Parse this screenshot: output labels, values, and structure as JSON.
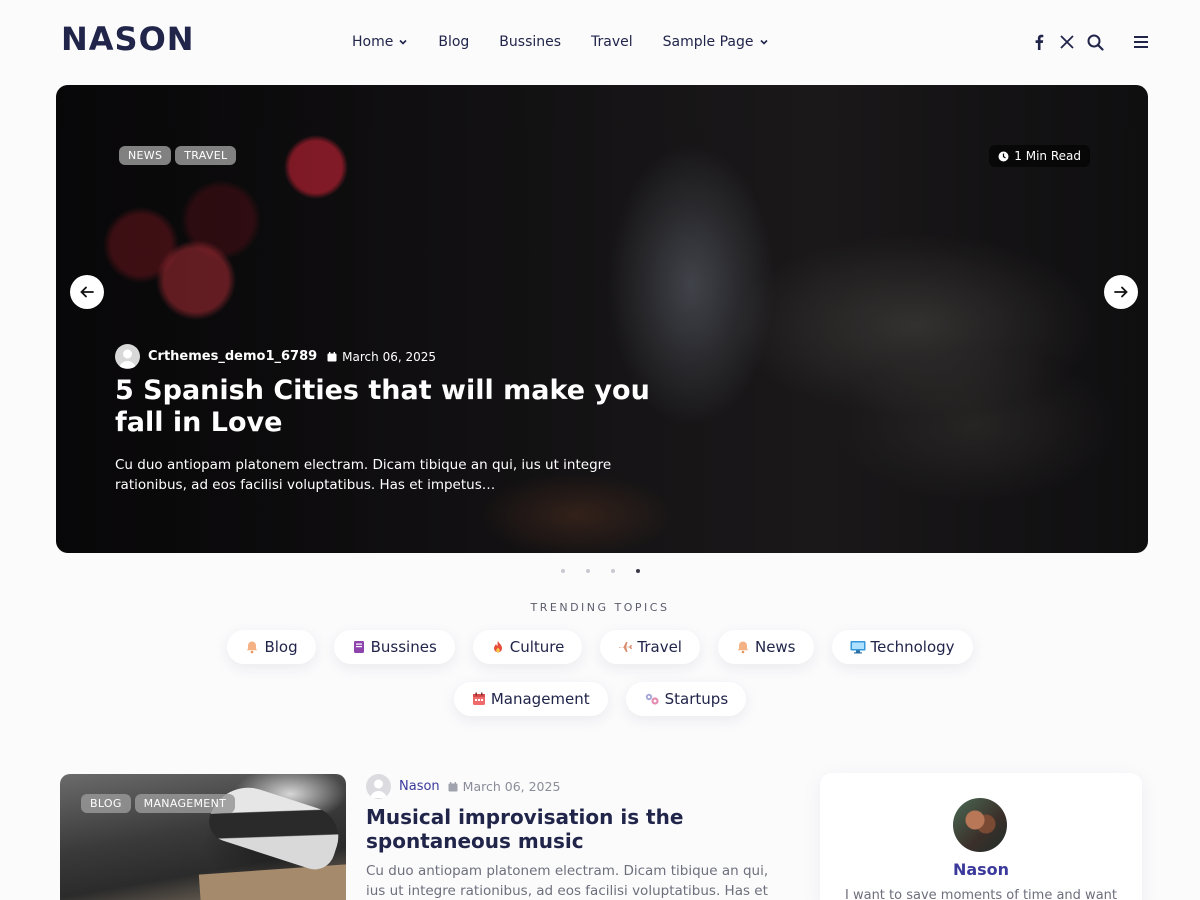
{
  "site": {
    "logo": "NASON"
  },
  "nav": {
    "items": [
      {
        "label": "Home",
        "has_dropdown": true
      },
      {
        "label": "Blog",
        "has_dropdown": false
      },
      {
        "label": "Bussines",
        "has_dropdown": false
      },
      {
        "label": "Travel",
        "has_dropdown": false
      },
      {
        "label": "Sample Page",
        "has_dropdown": true
      }
    ],
    "icons": [
      "facebook-icon",
      "x-twitter-icon",
      "search-icon",
      "menu-icon"
    ]
  },
  "hero": {
    "tags": [
      "NEWS",
      "TRAVEL"
    ],
    "read_time": "1 Min Read",
    "author": "Crthemes_demo1_6789",
    "date": "March 06, 2025",
    "title": "5 Spanish Cities that will make you fall in Love",
    "excerpt": "Cu duo antiopam platonem electram. Dicam tibique an qui, ius ut integre rationibus, ad eos facilisi voluptatibus. Has et impetus…",
    "slides_total": 4,
    "active_slide": 4
  },
  "trending": {
    "heading": "TRENDING TOPICS",
    "topics": [
      {
        "label": "Blog",
        "icon": "bell-icon"
      },
      {
        "label": "Bussines",
        "icon": "book-icon"
      },
      {
        "label": "Culture",
        "icon": "fire-icon"
      },
      {
        "label": "Travel",
        "icon": "airplane-icon"
      },
      {
        "label": "News",
        "icon": "bell-icon"
      },
      {
        "label": "Technology",
        "icon": "monitor-icon"
      },
      {
        "label": "Management",
        "icon": "calendar-icon"
      },
      {
        "label": "Startups",
        "icon": "gears-icon"
      }
    ]
  },
  "post": {
    "tags": [
      "BLOG",
      "MANAGEMENT"
    ],
    "author": "Nason",
    "date": "March 06, 2025",
    "title": "Musical improvisation is the spontaneous music",
    "excerpt": "Cu duo antiopam platonem electram. Dicam tibique an qui, ius ut integre rationibus, ad eos facilisi voluptatibus. Has et impetus…"
  },
  "author_widget": {
    "name": "Nason",
    "bio": "I want to save moments of time and want to"
  },
  "colors": {
    "accent": "#3b3a9c",
    "heading": "#21254a"
  }
}
